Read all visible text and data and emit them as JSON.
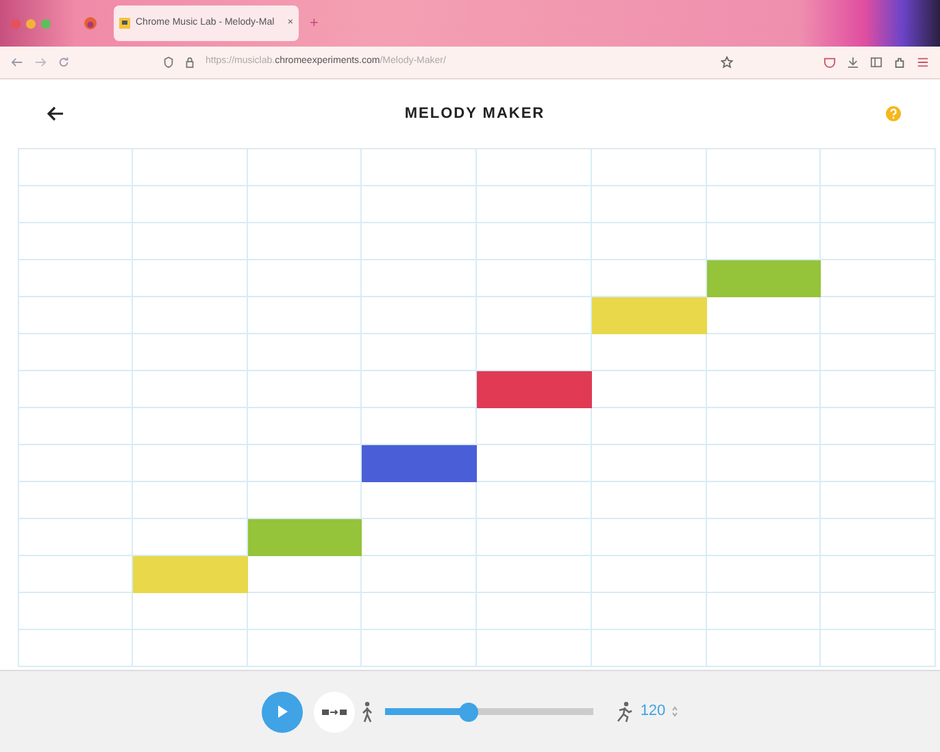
{
  "browser": {
    "tab": {
      "title": "Chrome Music Lab - Melody-Mal",
      "close": "×",
      "selected": true
    },
    "new_tab": "+",
    "url": {
      "prefix": "https://musiclab.",
      "domain": "chromeexperiments.com",
      "path": "/Melody-Maker/"
    }
  },
  "header": {
    "title": "MELODY MAKER"
  },
  "grid": {
    "rows": [
      {
        "cells": [
          {
            "on": false
          },
          {
            "on": false
          },
          {
            "on": false
          },
          {
            "on": false
          },
          {
            "on": false
          },
          {
            "on": false
          },
          {
            "on": false
          },
          {
            "on": false
          }
        ]
      },
      {
        "cells": [
          {
            "on": false
          },
          {
            "on": false
          },
          {
            "on": false
          },
          {
            "on": false
          },
          {
            "on": false
          },
          {
            "on": false
          },
          {
            "on": false
          },
          {
            "on": false
          }
        ]
      },
      {
        "cells": [
          {
            "on": false
          },
          {
            "on": false
          },
          {
            "on": false
          },
          {
            "on": false
          },
          {
            "on": false
          },
          {
            "on": false
          },
          {
            "on": false
          },
          {
            "on": false
          }
        ]
      },
      {
        "cells": [
          {
            "on": false
          },
          {
            "on": false
          },
          {
            "on": false
          },
          {
            "on": false
          },
          {
            "on": false
          },
          {
            "on": false
          },
          {
            "on": true,
            "color": "#95c33a"
          },
          {
            "on": false
          }
        ]
      },
      {
        "cells": [
          {
            "on": false
          },
          {
            "on": false
          },
          {
            "on": false
          },
          {
            "on": false
          },
          {
            "on": false
          },
          {
            "on": true,
            "color": "#e8d84a"
          },
          {
            "on": false
          },
          {
            "on": false
          }
        ]
      },
      {
        "cells": [
          {
            "on": false
          },
          {
            "on": false
          },
          {
            "on": false
          },
          {
            "on": false
          },
          {
            "on": false
          },
          {
            "on": false
          },
          {
            "on": false
          },
          {
            "on": false
          }
        ]
      },
      {
        "cells": [
          {
            "on": false
          },
          {
            "on": false
          },
          {
            "on": false
          },
          {
            "on": false
          },
          {
            "on": true,
            "color": "#e03a55"
          },
          {
            "on": false
          },
          {
            "on": false
          },
          {
            "on": false
          }
        ]
      },
      {
        "cells": [
          {
            "on": false
          },
          {
            "on": false
          },
          {
            "on": false
          },
          {
            "on": false
          },
          {
            "on": false
          },
          {
            "on": false
          },
          {
            "on": false
          },
          {
            "on": false
          }
        ]
      },
      {
        "cells": [
          {
            "on": false
          },
          {
            "on": false
          },
          {
            "on": false
          },
          {
            "on": true,
            "color": "#4a5ed8"
          },
          {
            "on": false
          },
          {
            "on": false
          },
          {
            "on": false
          },
          {
            "on": false
          }
        ]
      },
      {
        "cells": [
          {
            "on": false
          },
          {
            "on": false
          },
          {
            "on": false
          },
          {
            "on": false
          },
          {
            "on": false
          },
          {
            "on": false
          },
          {
            "on": false
          },
          {
            "on": false
          }
        ]
      },
      {
        "cells": [
          {
            "on": false
          },
          {
            "on": false
          },
          {
            "on": true,
            "color": "#95c33a"
          },
          {
            "on": false
          },
          {
            "on": false
          },
          {
            "on": false
          },
          {
            "on": false
          },
          {
            "on": false
          }
        ]
      },
      {
        "cells": [
          {
            "on": false
          },
          {
            "on": true,
            "color": "#e8d84a"
          },
          {
            "on": false
          },
          {
            "on": false
          },
          {
            "on": false
          },
          {
            "on": false
          },
          {
            "on": false
          },
          {
            "on": false
          }
        ]
      },
      {
        "cells": [
          {
            "on": false
          },
          {
            "on": false
          },
          {
            "on": false
          },
          {
            "on": false
          },
          {
            "on": false
          },
          {
            "on": false
          },
          {
            "on": false
          },
          {
            "on": false
          }
        ]
      },
      {
        "cells": [
          {
            "on": false
          },
          {
            "on": false
          },
          {
            "on": false
          },
          {
            "on": false
          },
          {
            "on": false
          },
          {
            "on": false
          },
          {
            "on": false
          },
          {
            "on": false
          }
        ]
      }
    ]
  },
  "controls": {
    "tempo": {
      "level": 0.4,
      "value": "120"
    }
  }
}
